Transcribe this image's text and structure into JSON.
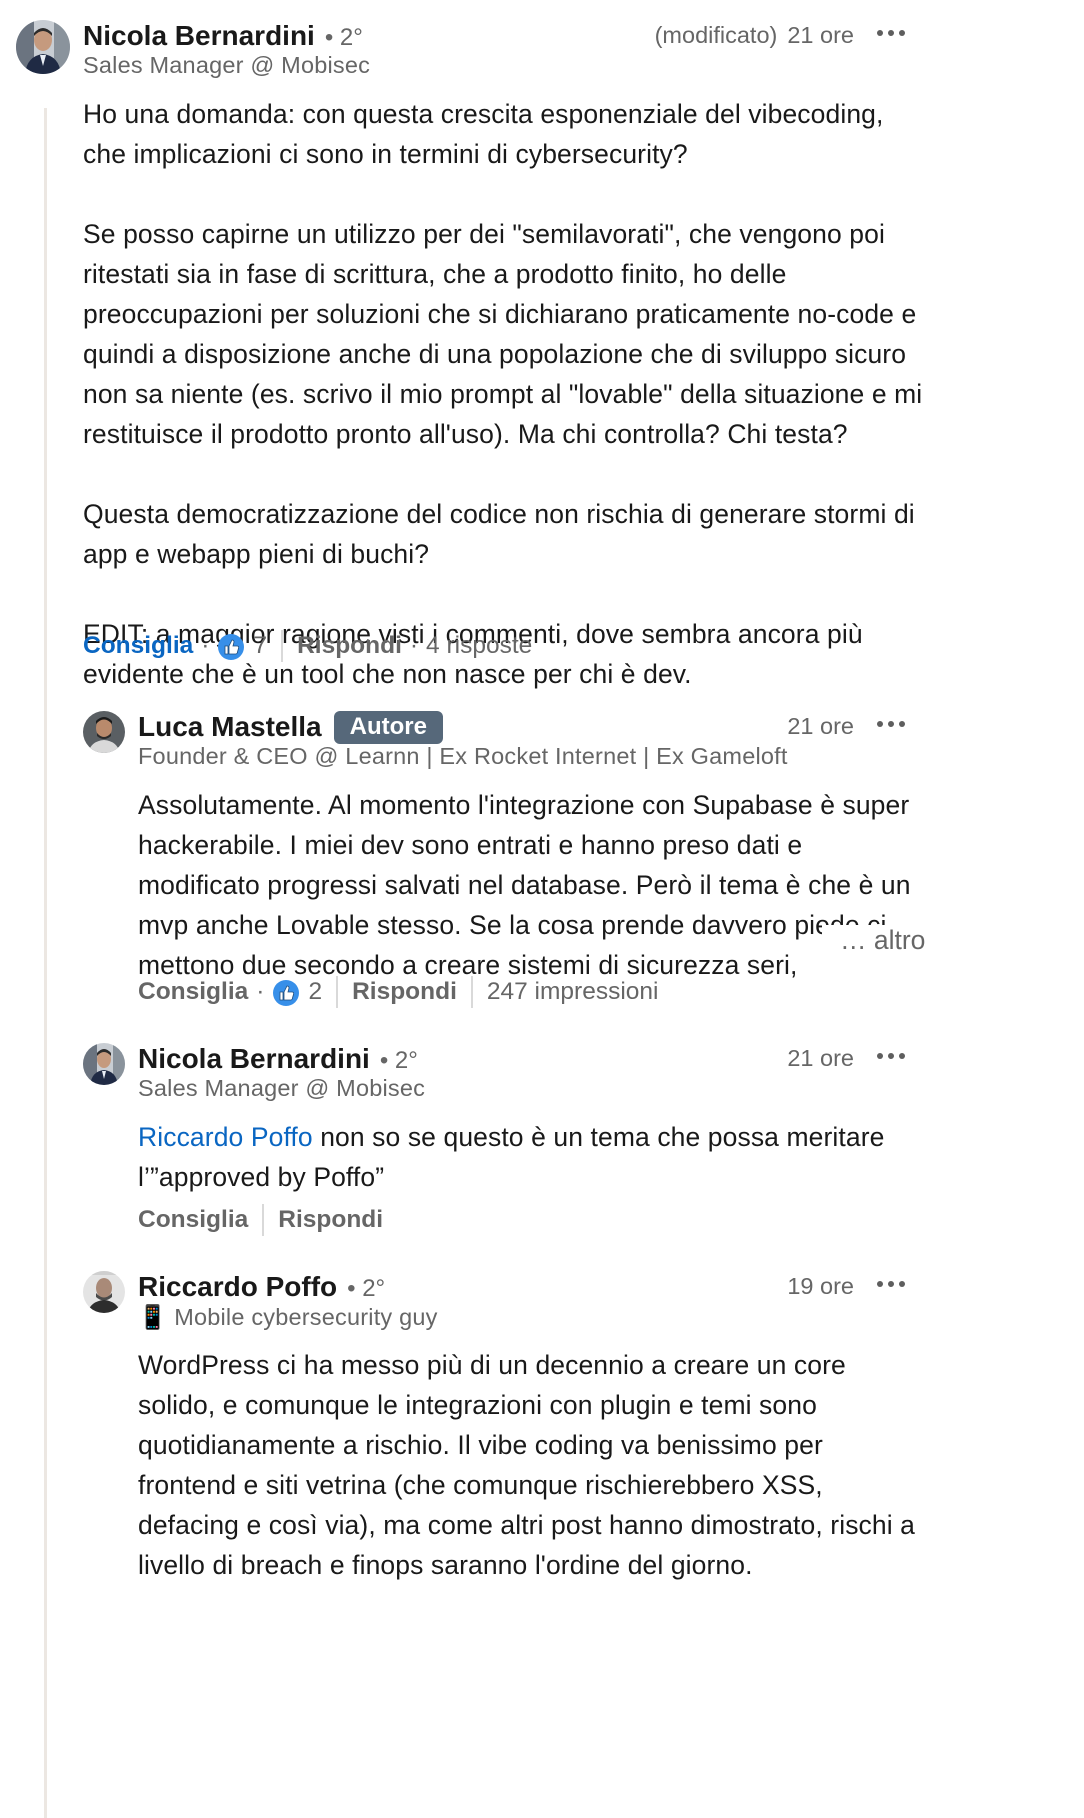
{
  "comments": [
    {
      "author": "Nicola Bernardini",
      "degree": "• 2°",
      "headline": "Sales Manager @ Mobisec",
      "edited": "(modificato)",
      "time": "21 ore",
      "paragraphs": [
        "Ho una domanda: con questa crescita esponenziale del vibecoding, che implicazioni ci sono in termini di cybersecurity?",
        "Se posso capirne un utilizzo per dei \"semilavorati\", che vengono poi ritestati sia in fase di scrittura, che a prodotto finito, ho delle preoccupazioni per soluzioni che si dichiarano praticamente no-code e quindi a disposizione anche di una popolazione che di sviluppo sicuro non sa niente (es. scrivo il mio prompt al \"lovable\" della situazione e mi restituisce il prodotto pronto all'uso). Ma chi controlla? Chi testa?",
        "Questa democratizzazione del codice non rischia di generare stormi di app e webapp pieni di buchi?",
        "EDIT: a maggior ragione visti i commenti, dove sembra ancora più evidente che è un tool che non nasce per chi è dev."
      ],
      "like_label": "Consiglia",
      "like_count": "7",
      "reply_label": "Rispondi",
      "replies": "4 risposte"
    },
    {
      "author": "Luca Mastella",
      "badge": "Autore",
      "headline": "Founder & CEO @ Learnn | Ex Rocket Internet | Ex Gameloft",
      "time": "21 ore",
      "text": "Assolutamente. Al momento l'integrazione con Supabase è super hackerabile. I miei dev sono entrati e hanno preso dati e modificato progressi salvati nel database. Però il tema è che è un mvp anche Lovable stesso. Se la cosa prende davvero piede ci mettono due secondo a creare sistemi di sicurezza seri, esattamente come",
      "more_label": "… altro",
      "like_label": "Consiglia",
      "like_count": "2",
      "reply_label": "Rispondi",
      "impressions": "247 impressioni"
    },
    {
      "author": "Nicola Bernardini",
      "degree": "• 2°",
      "headline": "Sales Manager @ Mobisec",
      "time": "21 ore",
      "mention": "Riccardo Poffo",
      "text": " non so se questo è un tema che possa meritare l’”approved by Poffo”",
      "like_label": "Consiglia",
      "reply_label": "Rispondi"
    },
    {
      "author": "Riccardo Poffo",
      "degree": "• 2°",
      "headline": "📱 Mobile cybersecurity guy",
      "time": "19 ore",
      "text": "WordPress ci ha messo più di un decennio a creare un core solido, e comunque le integrazioni con plugin e temi sono quotidianamente a rischio. Il vibe coding va benissimo per frontend e siti vetrina (che comunque rischierebbero XSS, defacing e così via), ma come altri post hanno dimostrato, rischi a livello di breach e finops saranno l'ordine del giorno."
    }
  ],
  "icons": {
    "more": "more-horizontal-icon",
    "like": "like-reaction-icon"
  },
  "colors": {
    "link_blue": "#0a66c2",
    "badge_bg": "#56687a",
    "muted_text": "#666666",
    "thread_line": "#ece7e2"
  }
}
